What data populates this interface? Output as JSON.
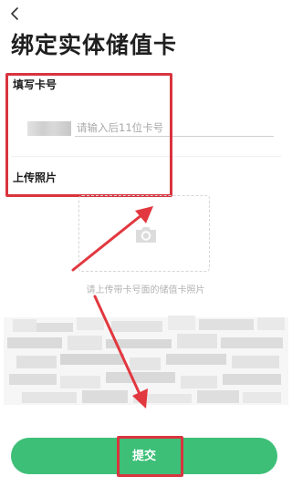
{
  "header": {
    "back_icon": "chevron-left-icon",
    "title": "绑定实体储值卡"
  },
  "form": {
    "card_number_label": "填写卡号",
    "card_number_placeholder": "请输入后11位卡号",
    "card_number_value": "",
    "photo_label": "上传照片"
  },
  "upload": {
    "icon": "camera-icon",
    "hint": "请上传带卡号面的储值卡照片"
  },
  "submit": {
    "label": "提交"
  },
  "colors": {
    "accent": "#3dbf78",
    "highlight": "#d9343f"
  }
}
